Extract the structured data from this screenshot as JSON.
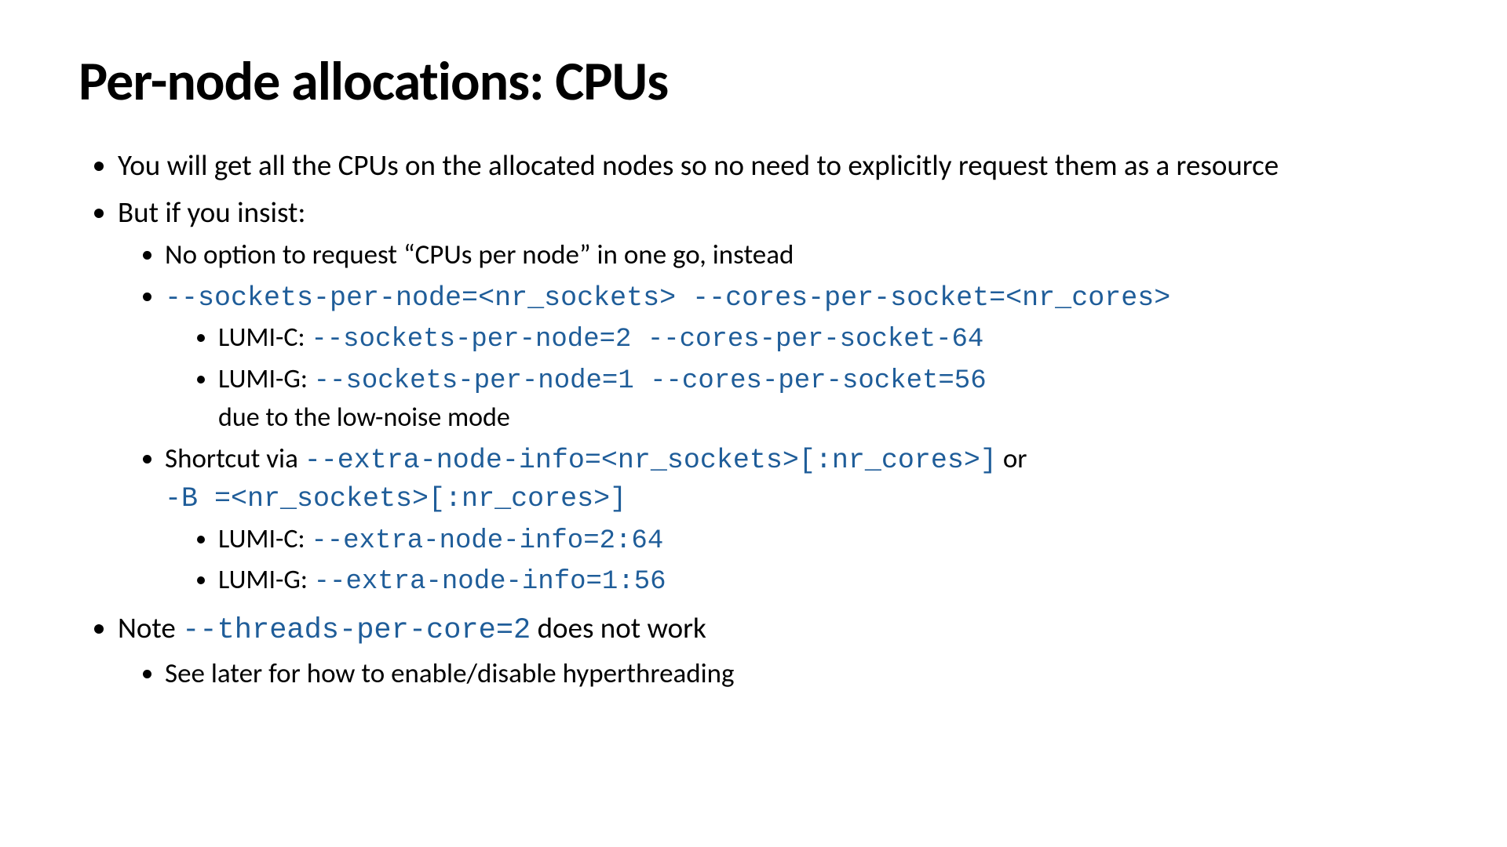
{
  "title": "Per-node allocations: CPUs",
  "b1": "You will get all the CPUs on the allocated nodes so no need to explicitly request them as a resource",
  "b2": "But if you insist:",
  "b2_1": "No option to request “CPUs per node” in one go, instead",
  "b2_2_code": "--sockets-per-node=<nr_sockets> --cores-per-socket=<nr_cores>",
  "b2_2_a_label": "LUMI-C: ",
  "b2_2_a_code": "--sockets-per-node=2 --cores-per-socket-64",
  "b2_2_b_label": "LUMI-G: ",
  "b2_2_b_code": "--sockets-per-node=1 --cores-per-socket=56",
  "b2_2_b_tail": "due to the low-noise mode",
  "b2_3_pre": "Shortcut via ",
  "b2_3_code1": "--extra-node-info=<nr_sockets>[:nr_cores>]",
  "b2_3_mid": " or ",
  "b2_3_code2": "-B =<nr_sockets>[:nr_cores>]",
  "b2_3_a_label": "LUMI-C: ",
  "b2_3_a_code": "--extra-node-info=2:64",
  "b2_3_b_label": "LUMI-G: ",
  "b2_3_b_code": "--extra-node-info=1:56",
  "b3_pre": "Note ",
  "b3_code": "--threads-per-core=2",
  "b3_post": " does not work",
  "b3_1": "See later for how to enable/disable hyperthreading"
}
